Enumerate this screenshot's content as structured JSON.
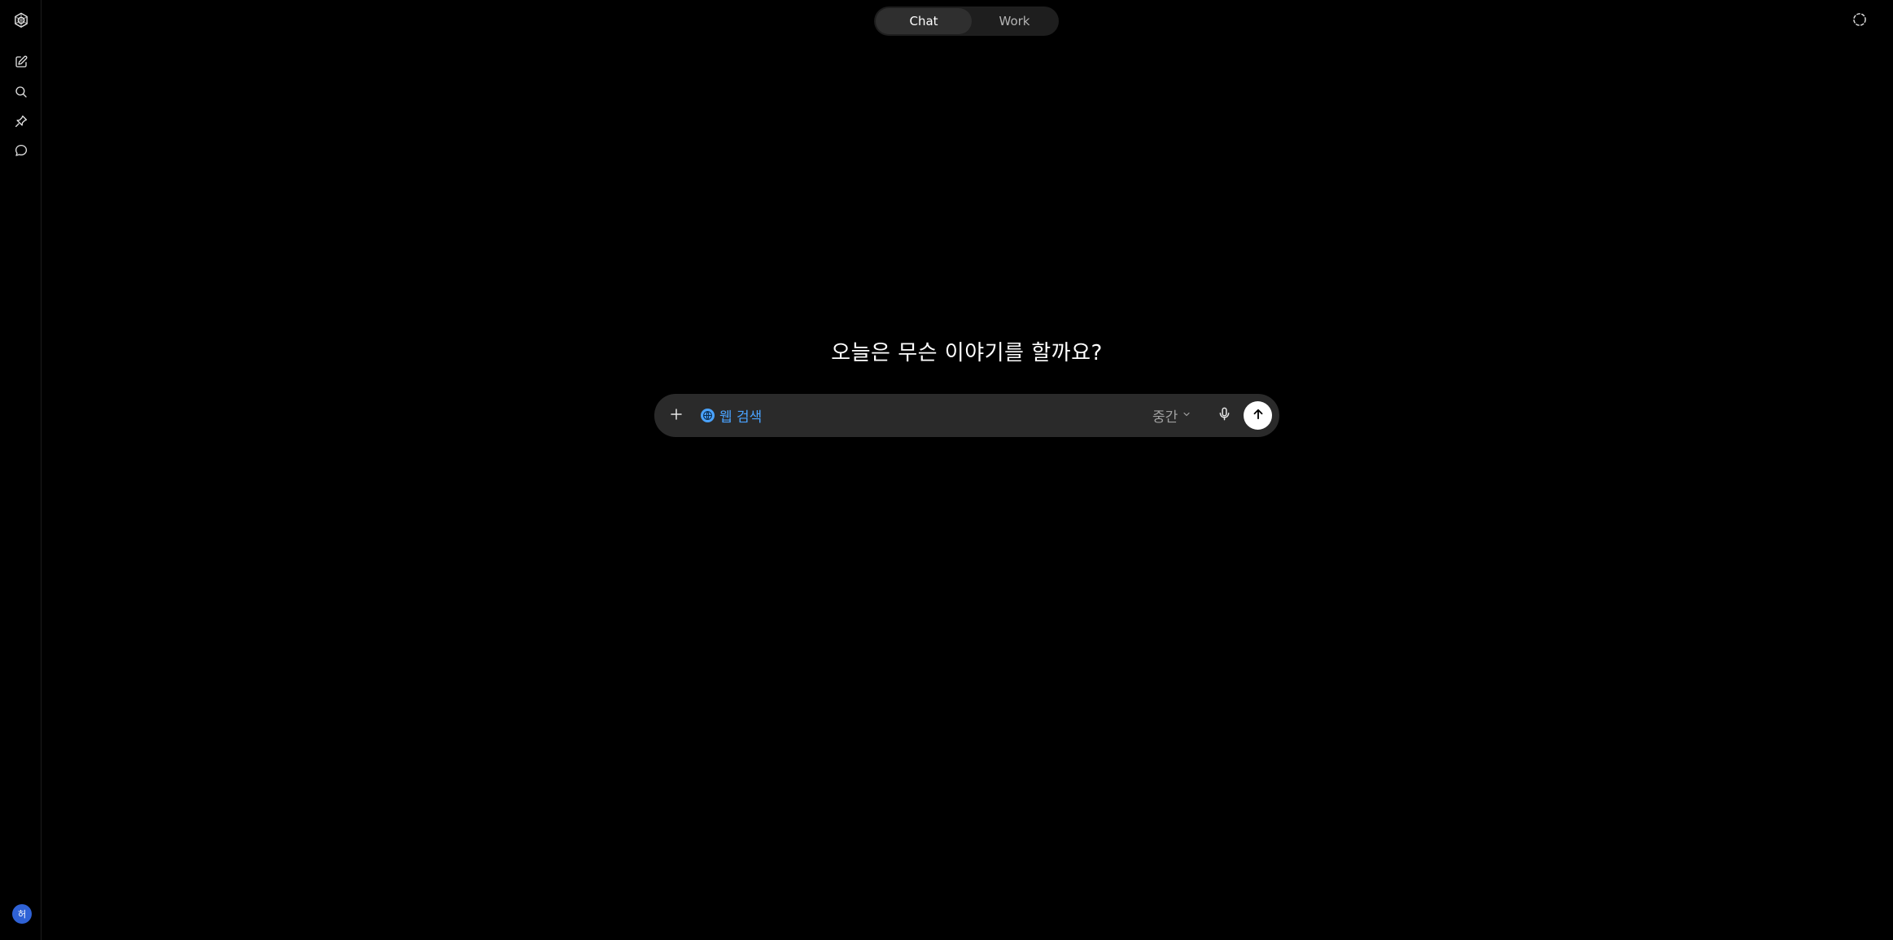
{
  "app": {
    "colors": {
      "background": "#000000",
      "composer_bg": "#2a2a2a",
      "accent_blue": "#4aa3ff",
      "avatar_bg": "#2f62d6"
    }
  },
  "sidebar": {
    "logo_icon": "openai-logo-icon",
    "items": [
      {
        "icon": "new-chat-icon"
      },
      {
        "icon": "search-icon"
      },
      {
        "icon": "pin-icon"
      },
      {
        "icon": "chat-bubble-icon"
      }
    ],
    "avatar_initial": "허"
  },
  "mode_toggle": {
    "tabs": [
      {
        "label": "Chat",
        "active": true
      },
      {
        "label": "Work",
        "active": false
      }
    ]
  },
  "top_right": {
    "icon": "temporary-chat-icon"
  },
  "main": {
    "headline": "오늘은 무슨 이야기를 할까요?"
  },
  "composer": {
    "plus_icon": "plus-icon",
    "web_search_label": "웹 검색",
    "web_search_icon": "globe-icon",
    "input_value": "",
    "effort_label": "중간",
    "effort_icon": "chevron-down-icon",
    "mic_icon": "microphone-icon",
    "send_icon": "arrow-up-icon"
  }
}
